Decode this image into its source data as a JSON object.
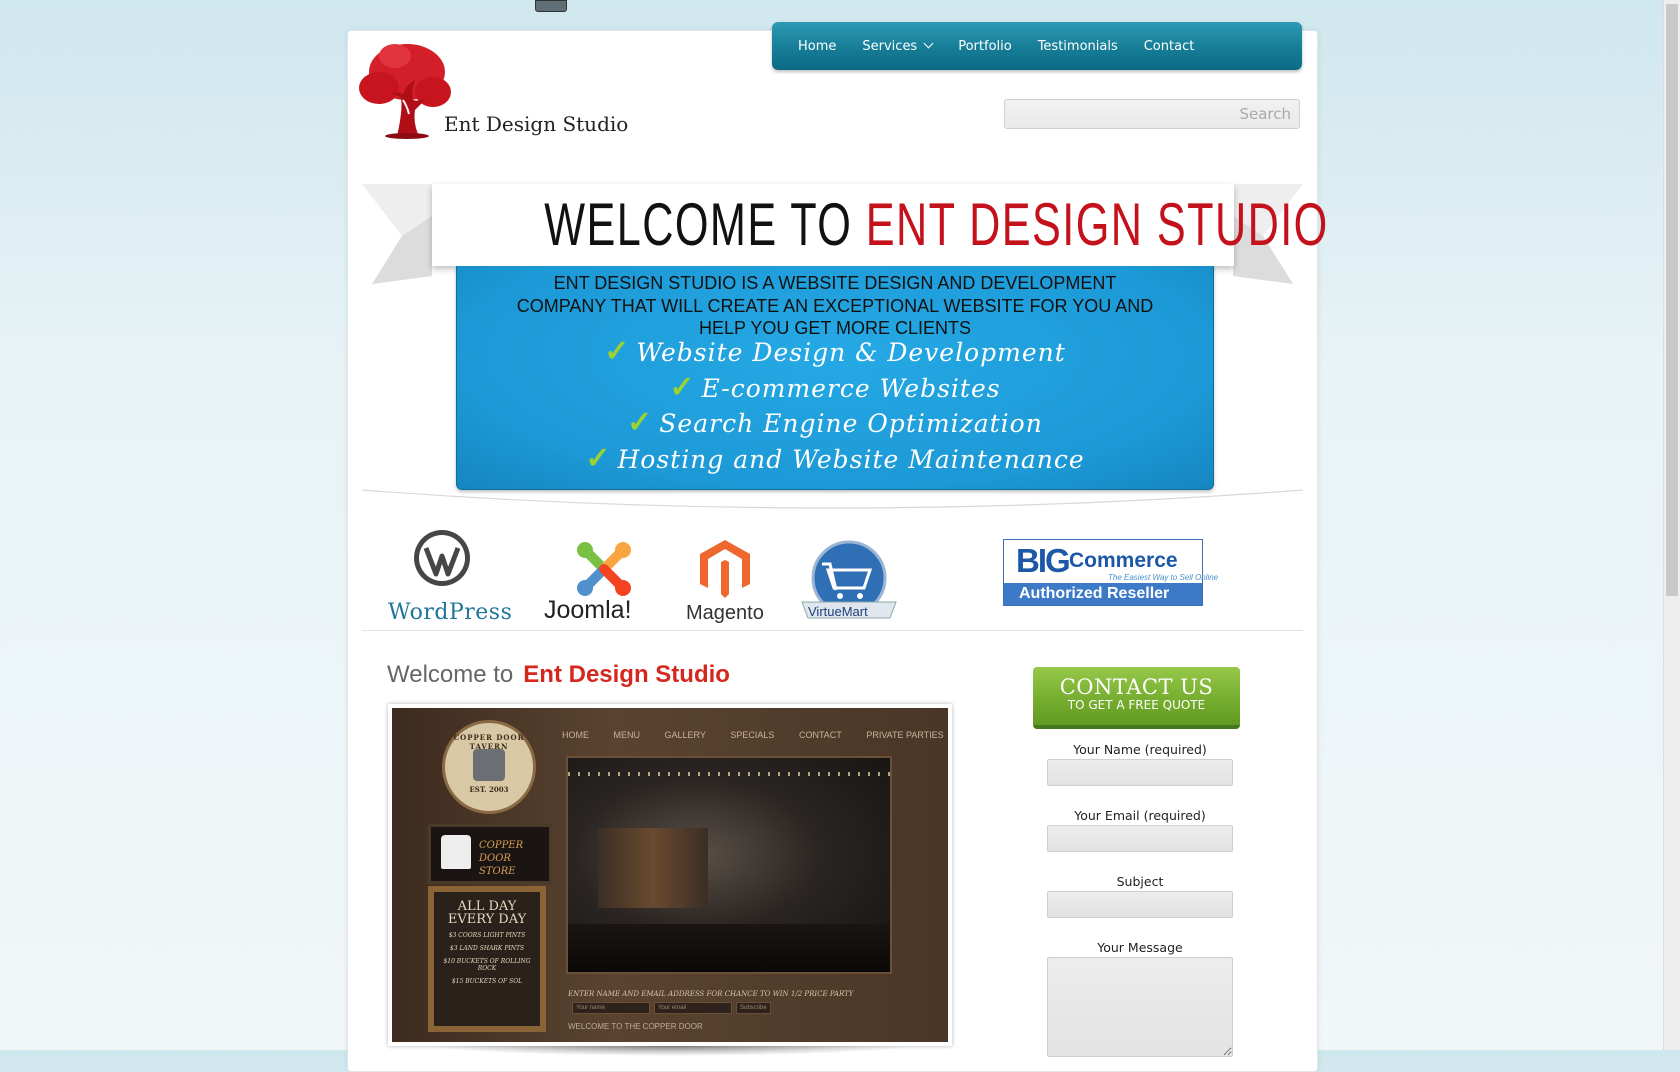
{
  "nav": {
    "items": [
      "Home",
      "Services",
      "Portfolio",
      "Testimonials",
      "Contact"
    ]
  },
  "brand": {
    "name": "Ent Design Studio"
  },
  "search": {
    "placeholder": "Search"
  },
  "banner": {
    "title_black": "WELCOME TO",
    "title_red": "ENT DESIGN STUDIO",
    "description": [
      "ENT DESIGN STUDIO IS A WEBSITE DESIGN AND  DEVELOPMENT",
      "COMPANY THAT WILL CREATE  AN EXCEPTIONAL WEBSITE FOR YOU AND",
      "HELP YOU GET MORE CLIENTS"
    ],
    "checklist": [
      "Website Design & Development",
      "E-commerce Websites",
      "Search Engine Optimization",
      "Hosting and Website Maintenance"
    ]
  },
  "platforms": {
    "wordpress": "WordPress",
    "joomla": "Joomla!",
    "magento": "Magento",
    "virtuemart": "VirtueMart",
    "bigcommerce": {
      "big": "BIG",
      "commerce": "Commerce",
      "tagline": "The Easiest Way to Sell Online",
      "reseller": "Authorized Reseller"
    }
  },
  "main": {
    "welcome_prefix": "Welcome to",
    "welcome_name": "Ent Design Studio"
  },
  "portfolio_shot": {
    "nav": [
      "HOME",
      "MENU",
      "GALLERY",
      "SPECIALS",
      "CONTACT",
      "PRIVATE PARTIES"
    ],
    "badge_top": "COPPER DOOR TAVERN",
    "badge_est": "EST. 2003",
    "store": [
      "COPPER DOOR",
      "STORE"
    ],
    "board_title": [
      "ALL DAY",
      "EVERY DAY"
    ],
    "board_lines": [
      "$3 COORS LIGHT PINTS",
      "$3 LAND SHARK PINTS",
      "$10 BUCKETS OF ROLLING ROCK",
      "$15 BUCKETS OF SOL"
    ],
    "footer_prompt": "ENTER NAME AND EMAIL ADDRESS FOR CHANCE TO WIN 1/2 PRICE PARTY",
    "field_name": "Your name",
    "field_email": "Your email",
    "subscribe": "Subscribe",
    "welcome": "WELCOME TO THE COPPER DOOR"
  },
  "contact": {
    "button_main": "CONTACT US",
    "button_sub": "TO GET A FREE QUOTE",
    "name_label": "Your Name (required)",
    "email_label": "Your Email (required)",
    "subject_label": "Subject",
    "message_label": "Your Message"
  },
  "colors": {
    "nav_blue": "#167d97",
    "banner_blue": "#1c99d6",
    "brand_red": "#c4121c",
    "check_green": "#9bd233",
    "contact_green": "#74ac2d"
  }
}
